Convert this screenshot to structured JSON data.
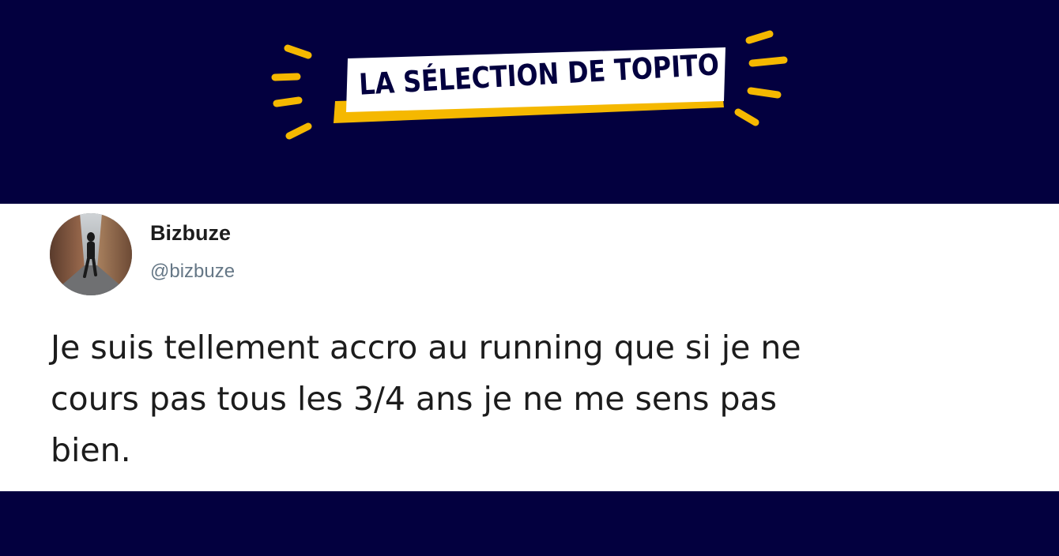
{
  "header": {
    "badge_title": "LA SÉLECTION DE TOPITO",
    "colors": {
      "background": "#03003f",
      "accent": "#f5b800",
      "badge_fill": "#ffffff"
    }
  },
  "tweet": {
    "author": {
      "display_name": "Bizbuze",
      "handle": "@bizbuze",
      "avatar_icon": "avatar-photo-runner"
    },
    "text_lines": [
      "Je suis tellement accro au running que si je ne",
      "cours pas tous les 3/4 ans je ne me sens pas",
      "bien."
    ]
  }
}
